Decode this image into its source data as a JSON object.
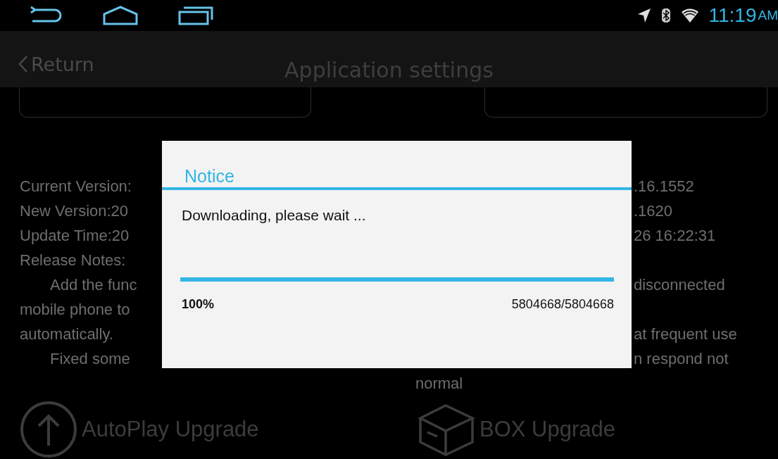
{
  "status_bar": {
    "time": "11:19",
    "meridiem": "AM"
  },
  "header": {
    "back_label": "Return",
    "title": "Application settings"
  },
  "left_lines": [
    {
      "text": "Current Version:",
      "kind": "plain"
    },
    {
      "text": "New Version:20",
      "kind": "plain"
    },
    {
      "text": "Update Time:20",
      "kind": "plain"
    },
    {
      "text": "Release Notes:",
      "kind": "plain"
    },
    {
      "text": "Add the func",
      "kind": "indent"
    },
    {
      "text": "mobile phone to",
      "kind": "plain"
    },
    {
      "text": "automatically.",
      "kind": "plain"
    },
    {
      "text": "Fixed some",
      "kind": "indent"
    }
  ],
  "right_versions": [
    ".16.1552",
    ".1620",
    "26 16:22:31"
  ],
  "right_notes": [
    {
      "lines": [
        {
          "text": "disconnected",
          "kind": "cut"
        }
      ]
    },
    {
      "lines": [
        {
          "text": "at frequent use",
          "kind": "cut"
        },
        {
          "text": "n respond not",
          "kind": "cut"
        },
        {
          "text": "normal",
          "kind": "plain"
        }
      ]
    }
  ],
  "upgrades": [
    {
      "label": "AutoPlay Upgrade",
      "kind": "upload"
    },
    {
      "label": "BOX Upgrade",
      "kind": "box"
    }
  ],
  "dialog": {
    "title": "Notice",
    "message": "Downloading, please wait ...",
    "progress": {
      "level": 1.0,
      "percent": "100%",
      "bytes": "5804668/5804668"
    }
  }
}
